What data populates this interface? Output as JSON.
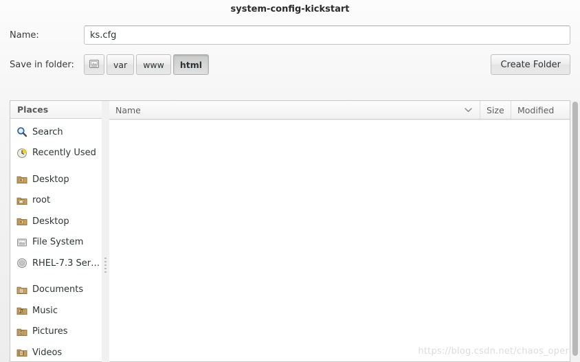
{
  "window": {
    "title": "system-config-kickstart"
  },
  "name_field": {
    "label": "Name:",
    "value": "ks.cfg",
    "placeholder": ""
  },
  "save_in_folder": {
    "label": "Save in folder:",
    "crumbs": [
      {
        "label": "",
        "icon": "filesystem-icon",
        "active": false
      },
      {
        "label": "var",
        "icon": "",
        "active": false
      },
      {
        "label": "www",
        "icon": "",
        "active": false
      },
      {
        "label": "html",
        "icon": "",
        "active": true
      }
    ],
    "create_folder_label": "Create Folder"
  },
  "sidebar": {
    "header": "Places",
    "items": [
      {
        "label": "Search",
        "icon": "search-icon"
      },
      {
        "label": "Recently Used",
        "icon": "recent-clock-icon"
      },
      {
        "label": "Desktop",
        "icon": "folder-desktop-icon"
      },
      {
        "label": "root",
        "icon": "folder-home-icon"
      },
      {
        "label": "Desktop",
        "icon": "folder-desktop-icon"
      },
      {
        "label": "File System",
        "icon": "drive-harddisk-icon"
      },
      {
        "label": "RHEL-7.3 Serve...",
        "icon": "media-optical-icon"
      },
      {
        "label": "Documents",
        "icon": "folder-documents-icon"
      },
      {
        "label": "Music",
        "icon": "folder-music-icon"
      },
      {
        "label": "Pictures",
        "icon": "folder-pictures-icon"
      },
      {
        "label": "Videos",
        "icon": "folder-videos-icon"
      }
    ]
  },
  "file_list": {
    "columns": [
      {
        "label": "Name",
        "sort_indicator": "⌄"
      },
      {
        "label": "Size"
      },
      {
        "label": "Modified"
      }
    ],
    "rows": []
  },
  "watermark": {
    "text": "https://blog.csdn.net/chaos_oper"
  },
  "colors": {
    "window_bg": "#ededed",
    "pane_bg": "#ffffff",
    "text": "#2e3436",
    "muted_text": "#5f5f5f",
    "border": "#c7c7c7",
    "active_crumb": "#d4d4d4",
    "scrollbar_thumb": "#b8b8b8",
    "watermark": "#dcdcdc"
  }
}
